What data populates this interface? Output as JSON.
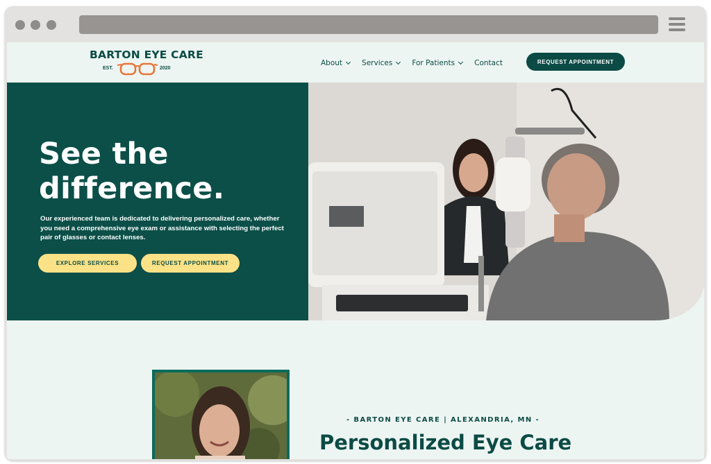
{
  "browser": {
    "controls": [
      "close-dot",
      "minimize-dot",
      "zoom-dot"
    ],
    "menu_icon": "hamburger-icon"
  },
  "header": {
    "logo": {
      "name": "BARTON EYE CARE",
      "est": "EST.",
      "year": "2020",
      "icon": "glasses-icon"
    },
    "nav": [
      {
        "label": "About",
        "has_dropdown": true
      },
      {
        "label": "Services",
        "has_dropdown": true
      },
      {
        "label": "For Patients",
        "has_dropdown": true
      },
      {
        "label": "Contact",
        "has_dropdown": false
      }
    ],
    "cta_label": "REQUEST APPOINTMENT"
  },
  "hero": {
    "title_line1": "See the",
    "title_line2": "difference.",
    "text": "Our experienced team is dedicated to delivering personalized care, whether you need a comprehensive eye exam or assistance with selecting the perfect pair of glasses or contact lenses.",
    "primary_button": "EXPLORE SERVICES",
    "secondary_button": "REQUEST APPOINTMENT"
  },
  "about": {
    "tagline": "- BARTON EYE CARE | ALEXANDRIA, MN -",
    "title": "Personalized Eye Care"
  },
  "colors": {
    "brand_green": "#0b4f48",
    "accent_yellow": "#fbe286",
    "page_bg": "#edf5f2",
    "glasses_orange": "#e8763a"
  }
}
